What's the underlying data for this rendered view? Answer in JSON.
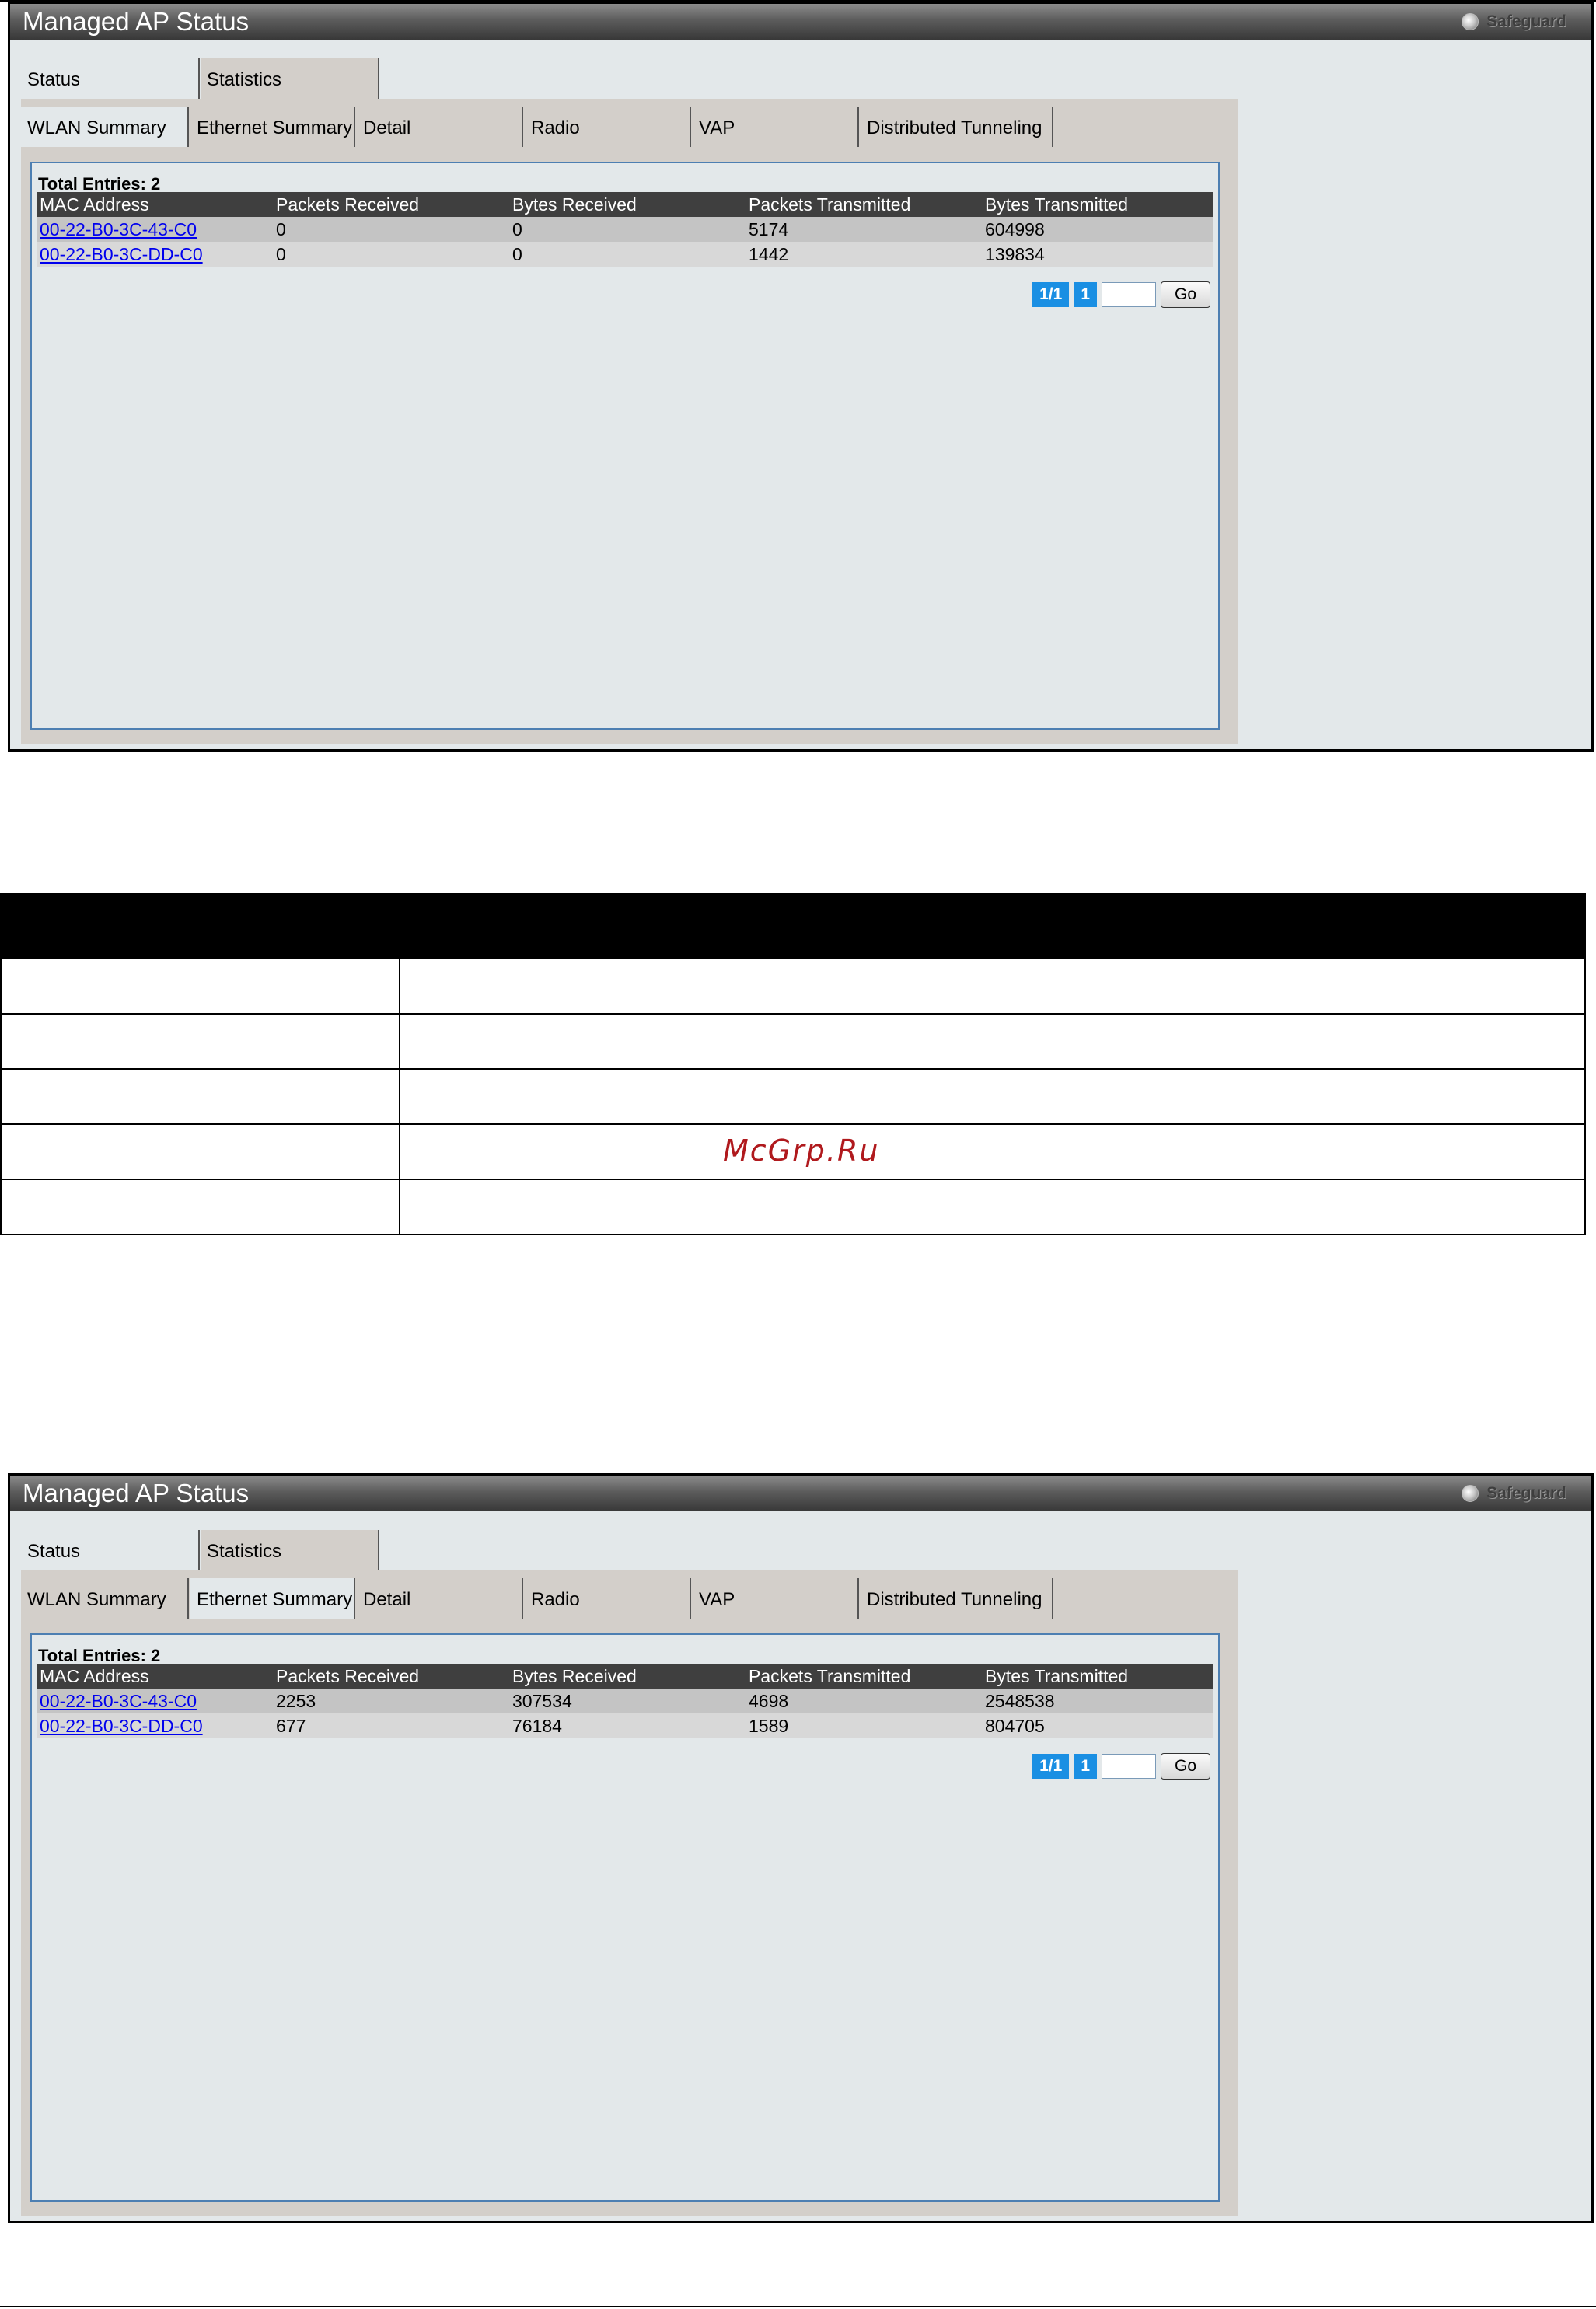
{
  "watermark": "McGrp.Ru",
  "panels": [
    {
      "title": "Managed AP Status",
      "safeguard_label": "Safeguard",
      "main_tabs": [
        "Status",
        "Statistics"
      ],
      "active_main_tab": "Statistics",
      "sub_tabs": [
        "WLAN Summary",
        "Ethernet Summary",
        "Detail",
        "Radio",
        "VAP",
        "Distributed Tunneling"
      ],
      "active_sub_tab": "WLAN Summary",
      "total_entries": "Total Entries: 2",
      "columns": [
        "MAC Address",
        "Packets Received",
        "Bytes Received",
        "Packets Transmitted",
        "Bytes Transmitted"
      ],
      "rows": [
        [
          "00-22-B0-3C-43-C0",
          "0",
          "0",
          "5174",
          "604998"
        ],
        [
          "00-22-B0-3C-DD-C0",
          "0",
          "0",
          "1442",
          "139834"
        ]
      ],
      "pager": {
        "pages": "1/1",
        "current": "1",
        "go_label": "Go"
      }
    },
    {
      "title": "Managed AP Status",
      "safeguard_label": "Safeguard",
      "main_tabs": [
        "Status",
        "Statistics"
      ],
      "active_main_tab": "Statistics",
      "sub_tabs": [
        "WLAN Summary",
        "Ethernet Summary",
        "Detail",
        "Radio",
        "VAP",
        "Distributed Tunneling"
      ],
      "active_sub_tab": "Ethernet Summary",
      "total_entries": "Total Entries: 2",
      "columns": [
        "MAC Address",
        "Packets Received",
        "Bytes Received",
        "Packets Transmitted",
        "Bytes Transmitted"
      ],
      "rows": [
        [
          "00-22-B0-3C-43-C0",
          "2253",
          "307534",
          "4698",
          "2548538"
        ],
        [
          "00-22-B0-3C-DD-C0",
          "677",
          "76184",
          "1589",
          "804705"
        ]
      ],
      "pager": {
        "pages": "1/1",
        "current": "1",
        "go_label": "Go"
      }
    }
  ]
}
